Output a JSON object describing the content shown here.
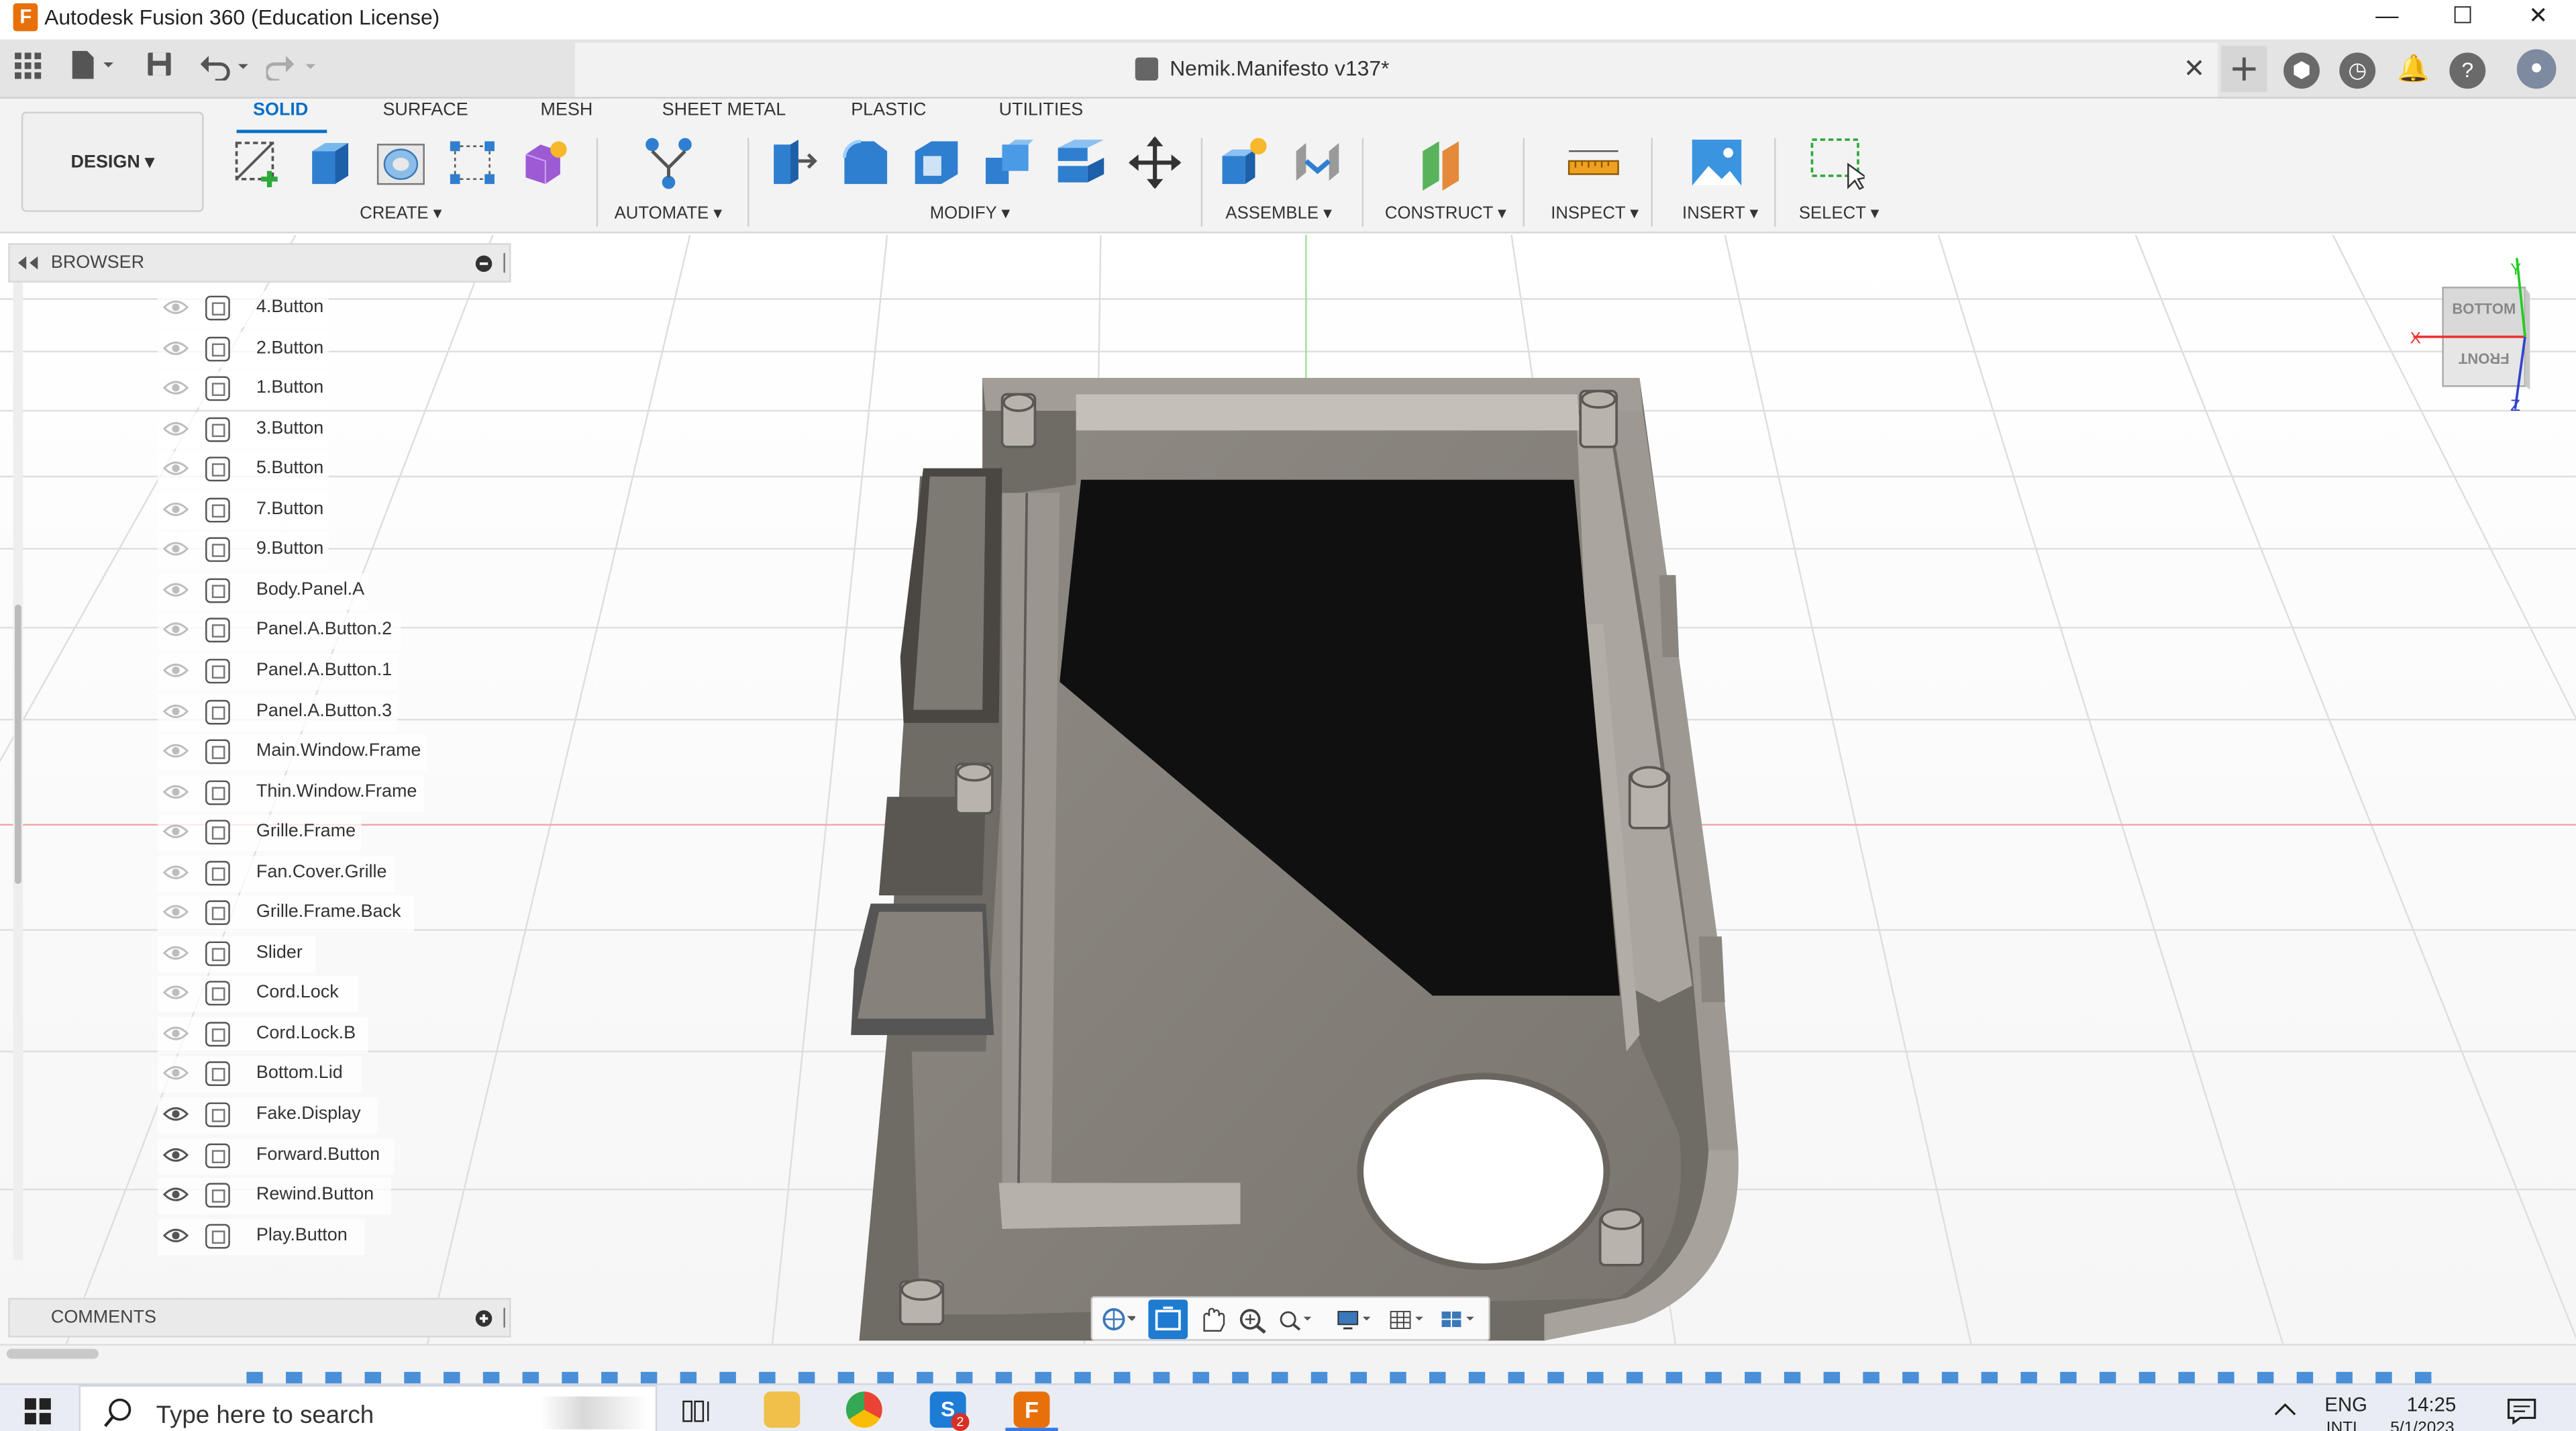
{
  "window": {
    "title": "Autodesk Fusion 360 (Education License)",
    "minimize": "—",
    "maximize": "☐",
    "close": "✕"
  },
  "document": {
    "name": "Nemik.Manifesto v137*",
    "close": "✕"
  },
  "workspace": {
    "label": "DESIGN ▾"
  },
  "tabs": [
    {
      "label": "SOLID",
      "active": true
    },
    {
      "label": "SURFACE"
    },
    {
      "label": "MESH"
    },
    {
      "label": "SHEET METAL"
    },
    {
      "label": "PLASTIC"
    },
    {
      "label": "UTILITIES"
    }
  ],
  "groups": {
    "create": "CREATE ▾",
    "automate": "AUTOMATE ▾",
    "modify": "MODIFY ▾",
    "assemble": "ASSEMBLE ▾",
    "construct": "CONSTRUCT ▾",
    "inspect": "INSPECT ▾",
    "insert": "INSERT ▾",
    "select": "SELECT ▾"
  },
  "browser": {
    "title": "BROWSER",
    "items": [
      {
        "label": "4.Button",
        "visible": false
      },
      {
        "label": "2.Button",
        "visible": false
      },
      {
        "label": "1.Button",
        "visible": false
      },
      {
        "label": "3.Button",
        "visible": false
      },
      {
        "label": "5.Button",
        "visible": false
      },
      {
        "label": "7.Button",
        "visible": false
      },
      {
        "label": "9.Button",
        "visible": false
      },
      {
        "label": "Body.Panel.A",
        "visible": false
      },
      {
        "label": "Panel.A.Button.2",
        "visible": false
      },
      {
        "label": "Panel.A.Button.1",
        "visible": false
      },
      {
        "label": "Panel.A.Button.3",
        "visible": false
      },
      {
        "label": "Main.Window.Frame",
        "visible": false
      },
      {
        "label": "Thin.Window.Frame",
        "visible": false
      },
      {
        "label": "Grille.Frame",
        "visible": false
      },
      {
        "label": "Fan.Cover.Grille",
        "visible": false
      },
      {
        "label": "Grille.Frame.Back",
        "visible": false
      },
      {
        "label": "Slider",
        "visible": false
      },
      {
        "label": "Cord.Lock",
        "visible": false
      },
      {
        "label": "Cord.Lock.B",
        "visible": false
      },
      {
        "label": "Bottom.Lid",
        "visible": false
      },
      {
        "label": "Fake.Display",
        "visible": true
      },
      {
        "label": "Forward.Button",
        "visible": true
      },
      {
        "label": "Rewind.Button",
        "visible": true
      },
      {
        "label": "Play.Button",
        "visible": true
      }
    ]
  },
  "comments": {
    "title": "COMMENTS"
  },
  "viewcube": {
    "top_face": "BOTTOM",
    "front_face": "FRONT",
    "axis_x": "X",
    "axis_y": "Y",
    "axis_z": "Z"
  },
  "taskbar": {
    "search_placeholder": "Type here to search",
    "lang": "ENG",
    "lang2": "INTL",
    "time": "14:25",
    "date": "5/1/2023",
    "notif_count": "2"
  },
  "colors": {
    "accent": "#0b6fc5",
    "model": "#8a8780",
    "display": "#101010",
    "grid": "#dcdcdc"
  }
}
